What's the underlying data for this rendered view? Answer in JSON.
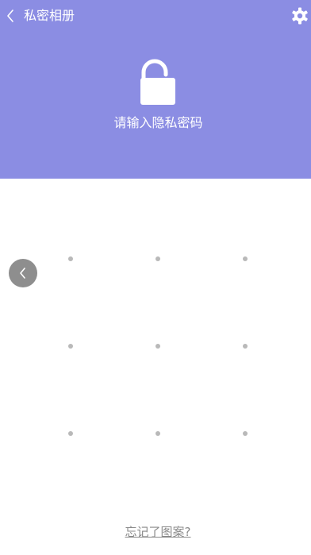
{
  "header": {
    "title": "私密相册",
    "prompt": "请输入隐私密码",
    "background_color": "#8b8de3",
    "icons": [
      "back-arrow",
      "gear",
      "unlocked-padlock"
    ]
  },
  "pattern_lock": {
    "rows": 3,
    "cols": 3,
    "dot_color": "#b9b9b9"
  },
  "side_button": {
    "icon": "chevron-left"
  },
  "footer": {
    "forgot_label": "忘记了图案?"
  }
}
